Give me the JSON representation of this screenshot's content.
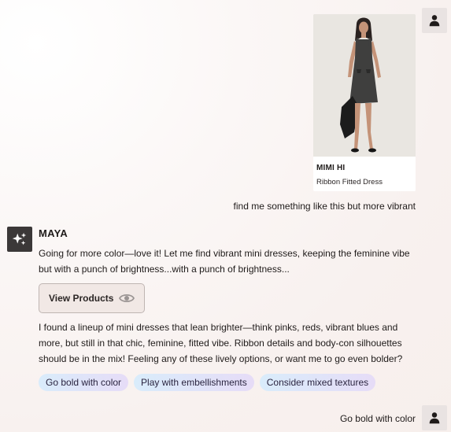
{
  "product": {
    "brand": "MIMI HI",
    "name": "Ribbon Fitted Dress"
  },
  "messages": {
    "user_1": "find me something like this but more vibrant",
    "user_2": "Go bold with color"
  },
  "bot": {
    "name": "MAYA",
    "intro": "Going for more color—love it! Let me find vibrant mini dresses, keeping the feminine vibe but with a punch of brightness...with a punch of brightness...",
    "view_products_label": "View Products",
    "reply": "I found a lineup of mini dresses that lean brighter—think pinks, reds, vibrant blues and more, but still in that chic, feminine, fitted vibe. Ribbon details and body-con silhouettes should be in the mix! Feeling any of these lively options, or want me to go even bolder?",
    "suggestions": [
      "Go bold with color",
      "Play with embellishments",
      "Consider mixed textures"
    ]
  },
  "icons": {
    "user_avatar": "person-icon",
    "bot_avatar": "sparkles-icon",
    "view_icon": "eye-icon"
  },
  "colors": {
    "chip_start": "#d9ecfb",
    "chip_end": "#e6dcf7",
    "bot_avatar_bg": "#3b3838",
    "button_bg": "#f1e8e5"
  }
}
